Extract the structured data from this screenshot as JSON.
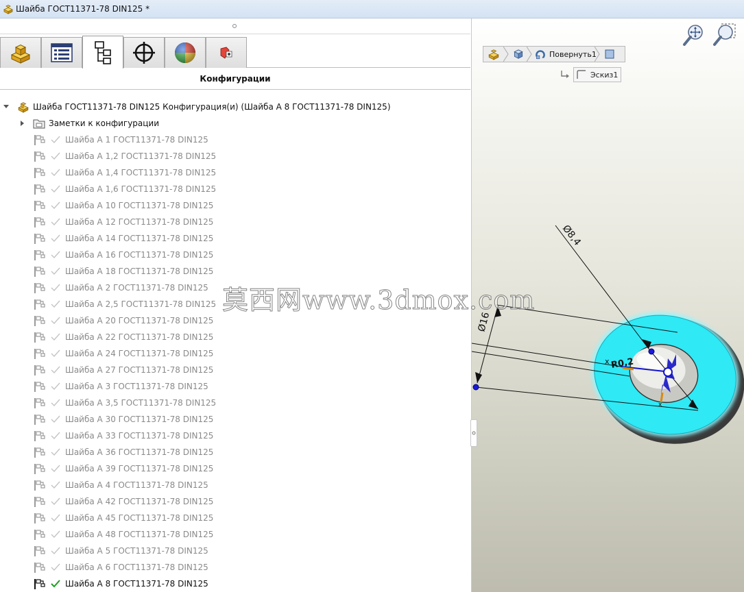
{
  "window": {
    "title": "Шайба ГОСТ11371-78 DIN125 *"
  },
  "tabs": [
    {
      "name": "featuremanager-tab",
      "icon": "part-icon"
    },
    {
      "name": "propertymanager-tab",
      "icon": "property-list-icon"
    },
    {
      "name": "configurationmanager-tab",
      "icon": "configuration-tree-icon",
      "active": true
    },
    {
      "name": "dimxpert-tab",
      "icon": "crosshair-icon"
    },
    {
      "name": "appearance-tab",
      "icon": "color-sphere-icon"
    },
    {
      "name": "cam-tab",
      "icon": "cam-icon"
    }
  ],
  "panel": {
    "header": "Конфигурации"
  },
  "tree": {
    "root": "Шайба ГОСТ11371-78 DIN125 Конфигурация(и)  (Шайба А 8 ГОСТ11371-78 DIN125)",
    "notes": "Заметки к конфигурации",
    "configurations": [
      "Шайба А 1 ГОСТ11371-78 DIN125",
      "Шайба А 1,2 ГОСТ11371-78 DIN125",
      "Шайба А 1,4 ГОСТ11371-78 DIN125",
      "Шайба А 1,6 ГОСТ11371-78 DIN125",
      "Шайба А 10 ГОСТ11371-78 DIN125",
      "Шайба А 12 ГОСТ11371-78 DIN125",
      "Шайба А 14 ГОСТ11371-78 DIN125",
      "Шайба А 16 ГОСТ11371-78 DIN125",
      "Шайба А 18 ГОСТ11371-78 DIN125",
      "Шайба А 2 ГОСТ11371-78 DIN125",
      "Шайба А 2,5 ГОСТ11371-78 DIN125",
      "Шайба А 20 ГОСТ11371-78 DIN125",
      "Шайба А 22 ГОСТ11371-78 DIN125",
      "Шайба А 24 ГОСТ11371-78 DIN125",
      "Шайба А 27 ГОСТ11371-78 DIN125",
      "Шайба А 3 ГОСТ11371-78 DIN125",
      "Шайба А 3,5 ГОСТ11371-78 DIN125",
      "Шайба А 30 ГОСТ11371-78 DIN125",
      "Шайба А 33 ГОСТ11371-78 DIN125",
      "Шайба А 36 ГОСТ11371-78 DIN125",
      "Шайба А 39 ГОСТ11371-78 DIN125",
      "Шайба А 4 ГОСТ11371-78 DIN125",
      "Шайба А 42 ГОСТ11371-78 DIN125",
      "Шайба А 45 ГОСТ11371-78 DIN125",
      "Шайба А 48 ГОСТ11371-78 DIN125",
      "Шайба А 5 ГОСТ11371-78 DIN125",
      "Шайба А 6 ГОСТ11371-78 DIN125",
      "Шайба А 8 ГОСТ11371-78 DIN125"
    ],
    "active_configuration": "Шайба А 8 ГОСТ11371-78 DIN125"
  },
  "viewport": {
    "breadcrumb": {
      "feature": "Повернуть1"
    },
    "sub_breadcrumb": "Эскиз1",
    "dimensions": {
      "outer_diameter": "Ø16",
      "inner_diameter": "Ø8,4",
      "radius": "R0,2"
    },
    "colors": {
      "selection_highlight": "#2fe9f5",
      "sketch_entities": "#1414c8",
      "active_check": "#1f9e1f",
      "inactive_check": "#c4c4c4"
    }
  },
  "watermark": "莫西网www.3dmox.com"
}
